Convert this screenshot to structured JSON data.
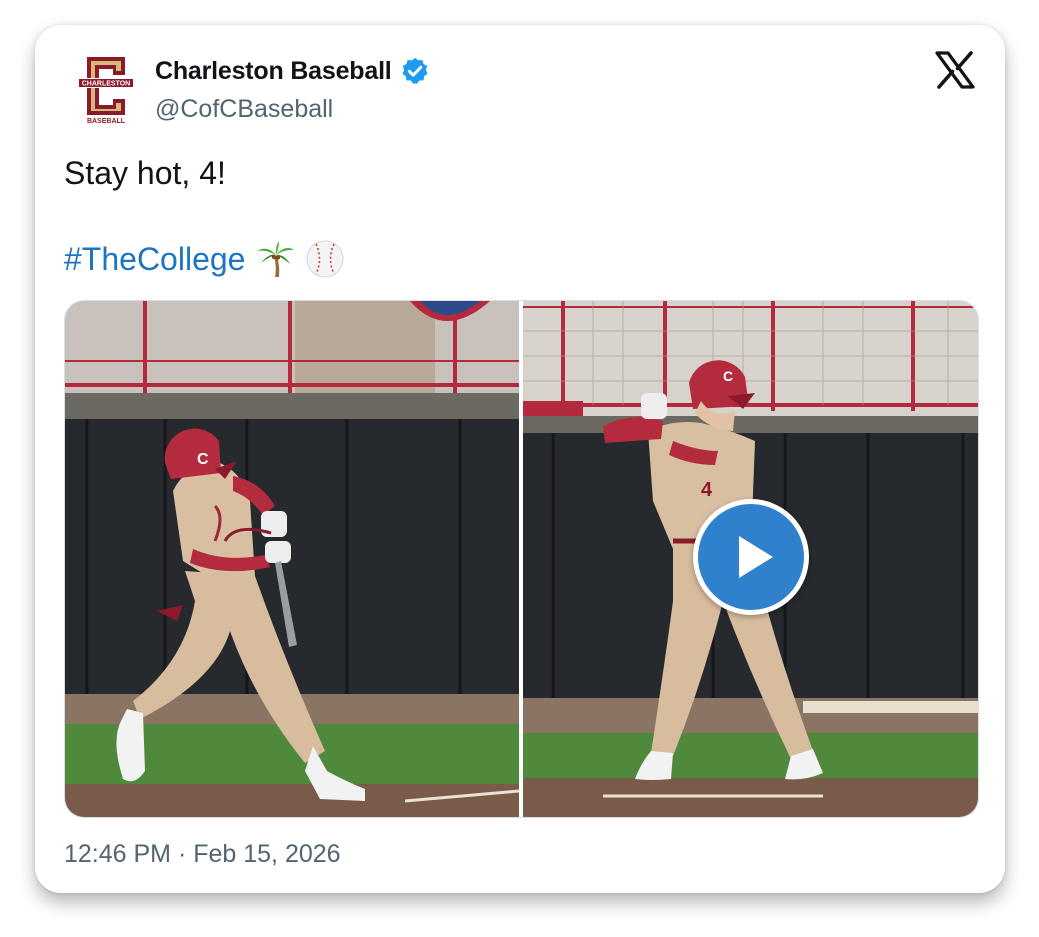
{
  "account": {
    "display_name": "Charleston Baseball",
    "handle": "@CofCBaseball",
    "verified": true,
    "avatar_text_top": "CHARLESTON",
    "avatar_text_bottom": "BASEBALL",
    "avatar_letter": "C"
  },
  "tweet": {
    "text": "Stay hot, 4!",
    "hashtag": "#TheCollege",
    "emojis": [
      "palm-tree-icon",
      "baseball-icon"
    ],
    "timestamp": "12:46 PM · Feb 15, 2026"
  },
  "media": {
    "items": [
      {
        "type": "photo",
        "description_icon": "photo-batter-swing"
      },
      {
        "type": "video",
        "description_icon": "photo-batter-stance",
        "has_play_button": true
      }
    ],
    "jersey_letter": "C",
    "jersey_number": "4"
  },
  "colors": {
    "maroon": "#8b1a2b",
    "link_blue": "#1d74c4",
    "verified_blue": "#1d9bf0",
    "play_blue": "#2f80cd",
    "text_primary": "#0f1419",
    "text_secondary": "#536471"
  },
  "brand": {
    "platform_logo": "x-logo-icon"
  }
}
